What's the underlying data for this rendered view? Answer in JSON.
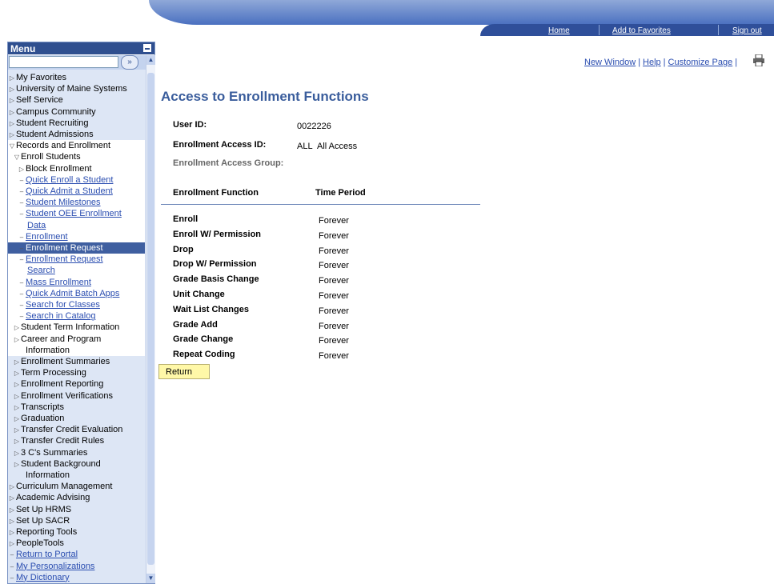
{
  "topnav": {
    "home": "Home",
    "add_favorites": "Add to Favorites",
    "sign_out": "Sign out"
  },
  "menu": {
    "title": "Menu",
    "search_placeholder": "",
    "go_icon": "double-chevron-right",
    "items": [
      {
        "label": "My Favorites",
        "kind": "folder"
      },
      {
        "label": "University of Maine Systems",
        "kind": "folder"
      },
      {
        "label": "Self Service",
        "kind": "folder"
      },
      {
        "label": "Campus Community",
        "kind": "folder"
      },
      {
        "label": "Student Recruiting",
        "kind": "folder"
      },
      {
        "label": "Student Admissions",
        "kind": "folder"
      },
      {
        "label": "Records and Enrollment",
        "kind": "folder-open"
      },
      {
        "label": "Enroll Students",
        "kind": "folder-open"
      },
      {
        "label": "Block Enrollment",
        "kind": "folder"
      },
      {
        "label": "Quick Enroll a Student",
        "kind": "link"
      },
      {
        "label": "Quick Admit a Student",
        "kind": "link"
      },
      {
        "label": "Student Milestones",
        "kind": "link"
      },
      {
        "label": "Student OEE Enrollment",
        "kind": "link"
      },
      {
        "label": "Data",
        "kind": "link-cont"
      },
      {
        "label": "Enrollment",
        "kind": "link"
      },
      {
        "label": "Enrollment Request",
        "kind": "selected"
      },
      {
        "label": "Enrollment Request",
        "kind": "link"
      },
      {
        "label": "Search",
        "kind": "link-cont"
      },
      {
        "label": "Mass Enrollment",
        "kind": "link"
      },
      {
        "label": "Quick Admit Batch Apps",
        "kind": "link"
      },
      {
        "label": "Search for Classes",
        "kind": "link"
      },
      {
        "label": "Search in Catalog",
        "kind": "link"
      },
      {
        "label": "Student Term Information",
        "kind": "folder"
      },
      {
        "label": "Career and Program",
        "kind": "folder"
      },
      {
        "label": "Information",
        "kind": "cont"
      },
      {
        "label": "Enrollment Summaries",
        "kind": "folder"
      },
      {
        "label": "Term Processing",
        "kind": "folder"
      },
      {
        "label": "Enrollment Reporting",
        "kind": "folder"
      },
      {
        "label": "Enrollment Verifications",
        "kind": "folder"
      },
      {
        "label": "Transcripts",
        "kind": "folder"
      },
      {
        "label": "Graduation",
        "kind": "folder"
      },
      {
        "label": "Transfer Credit Evaluation",
        "kind": "folder"
      },
      {
        "label": "Transfer Credit Rules",
        "kind": "folder"
      },
      {
        "label": "3 C's Summaries",
        "kind": "folder"
      },
      {
        "label": "Student Background",
        "kind": "folder"
      },
      {
        "label": "Information",
        "kind": "cont"
      },
      {
        "label": "Curriculum Management",
        "kind": "folder"
      },
      {
        "label": "Academic Advising",
        "kind": "folder"
      },
      {
        "label": "Set Up HRMS",
        "kind": "folder"
      },
      {
        "label": "Set Up SACR",
        "kind": "folder"
      },
      {
        "label": "Reporting Tools",
        "kind": "folder"
      },
      {
        "label": "PeopleTools",
        "kind": "folder"
      },
      {
        "label": "Return to Portal",
        "kind": "link"
      },
      {
        "label": "My Personalizations",
        "kind": "link"
      },
      {
        "label": "My Dictionary",
        "kind": "link"
      }
    ]
  },
  "pagelinks": {
    "new_window": "New Window",
    "help": "Help",
    "customize": "Customize Page",
    "sep": "|"
  },
  "page": {
    "title": "Access to Enrollment Functions",
    "user_id_label": "User ID:",
    "user_id_value": "0022226",
    "access_id_label": "Enrollment Access ID:",
    "access_id_code": "ALL",
    "access_id_desc": "All Access",
    "access_group_label": "Enrollment Access Group:",
    "col_function": "Enrollment Function",
    "col_period": "Time Period",
    "rows": [
      {
        "function": "Enroll",
        "period": "Forever"
      },
      {
        "function": "Enroll W/ Permission",
        "period": "Forever"
      },
      {
        "function": "Drop",
        "period": "Forever"
      },
      {
        "function": "Drop W/ Permission",
        "period": "Forever"
      },
      {
        "function": "Grade Basis Change",
        "period": "Forever"
      },
      {
        "function": "Unit Change",
        "period": "Forever"
      },
      {
        "function": "Wait List Changes",
        "period": "Forever"
      },
      {
        "function": "Grade Add",
        "period": "Forever"
      },
      {
        "function": "Grade Change",
        "period": "Forever"
      },
      {
        "function": "Repeat Coding",
        "period": "Forever"
      }
    ],
    "return_label": "Return"
  }
}
